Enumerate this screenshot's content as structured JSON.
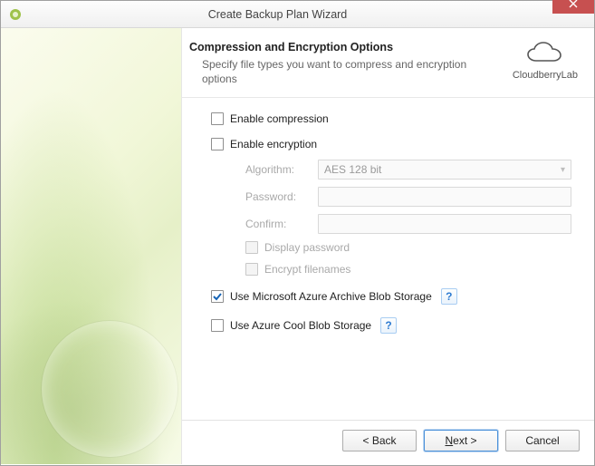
{
  "window": {
    "title": "Create Backup Plan Wizard"
  },
  "brand": {
    "name": "CloudberryLab"
  },
  "header": {
    "heading": "Compression and Encryption Options",
    "sub": "Specify file types you want to compress and encryption options"
  },
  "options": {
    "enable_compression": {
      "label": "Enable compression",
      "checked": false
    },
    "enable_encryption": {
      "label": "Enable encryption",
      "checked": false
    },
    "algorithm_label": "Algorithm:",
    "algorithm_value": "AES 128 bit",
    "password_label": "Password:",
    "confirm_label": "Confirm:",
    "display_password": {
      "label": "Display password",
      "checked": false
    },
    "encrypt_filenames": {
      "label": "Encrypt filenames",
      "checked": false
    },
    "azure_archive": {
      "label": "Use Microsoft Azure Archive Blob Storage",
      "checked": true
    },
    "azure_cool": {
      "label": "Use Azure Cool Blob Storage",
      "checked": false
    }
  },
  "buttons": {
    "back": "< Back",
    "next_prefix": "N",
    "next_suffix": "ext >",
    "cancel": "Cancel"
  }
}
